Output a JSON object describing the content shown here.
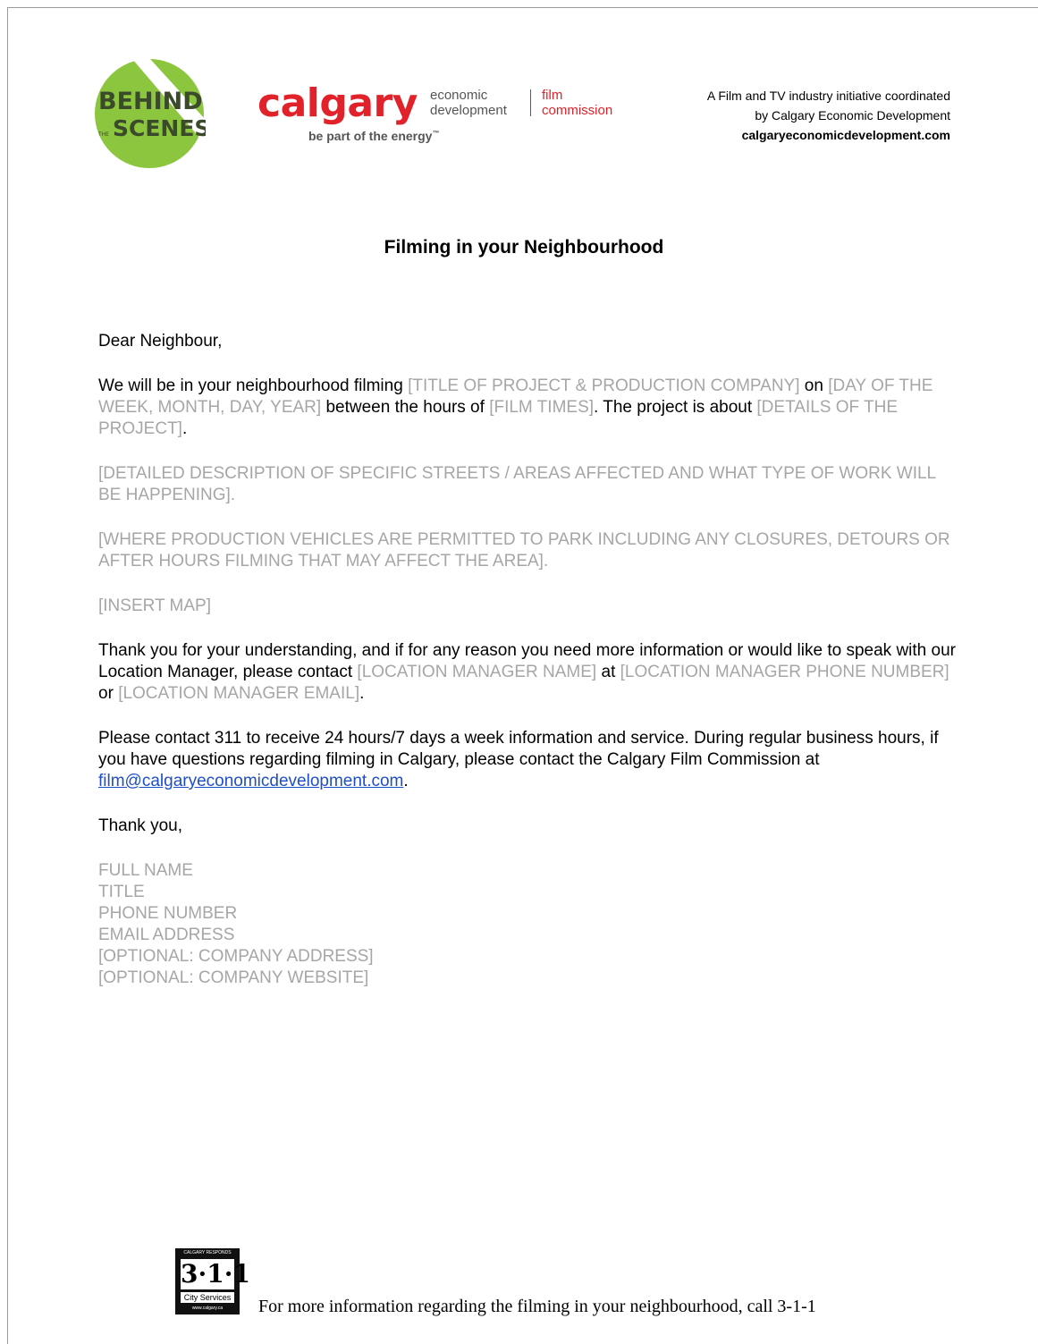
{
  "header": {
    "bts_logo": {
      "line1": "BEHIND",
      "line2_small": "THE",
      "line2": "SCENES"
    },
    "calgary_word": "calgary",
    "econ_dev_line1": "economic",
    "econ_dev_line2": "development",
    "film_comm_line1": "film",
    "film_comm_line2": "commission",
    "tagline": "be part of the energy",
    "tagline_mark": "™",
    "initiative_line1": "A Film and TV industry initiative coordinated",
    "initiative_line2": "by Calgary Economic Development",
    "initiative_url": "calgaryeconomicdevelopment.com"
  },
  "title": "Filming in your Neighbourhood",
  "greeting": "Dear Neighbour,",
  "para1": {
    "t1": "We will be in your neighbourhood filming ",
    "ph1": "[TITLE OF PROJECT & PRODUCTION COMPANY]",
    "t2": " on ",
    "ph2": "[DAY OF THE WEEK, MONTH, DAY, YEAR]",
    "t3": " between the hours of ",
    "ph3": "[FILM TIMES]",
    "t4": ". The project is about ",
    "ph4": "[DETAILS OF THE PROJECT]",
    "t5": "."
  },
  "para2": "[DETAILED DESCRIPTION OF SPECIFIC STREETS / AREAS AFFECTED AND WHAT TYPE OF WORK WILL BE HAPPENING].",
  "para3": "[WHERE PRODUCTION VEHICLES ARE PERMITTED TO PARK INCLUDING ANY CLOSURES, DETOURS OR AFTER HOURS FILMING THAT MAY AFFECT THE AREA].",
  "para4": "[INSERT MAP]",
  "para5": {
    "t1": "Thank you for your understanding, and if for any reason you need more information or would like to speak with our Location Manager, please contact ",
    "ph1": "[LOCATION MANAGER NAME]",
    "t2": " at ",
    "ph2": "[LOCATION MANAGER PHONE NUMBER]",
    "t3": " or ",
    "ph3": "[LOCATION MANAGER EMAIL]",
    "t4": "."
  },
  "para6": {
    "t1": "Please contact 311 to receive 24 hours/7 days a week information and service. During regular business hours, if you have questions regarding filming in Calgary, please contact the Calgary Film Commission at ",
    "email": "film@calgaryeconomicdevelopment.com",
    "t2": "."
  },
  "closing": "Thank you,",
  "signature": [
    "FULL NAME",
    "TITLE",
    "PHONE NUMBER",
    "EMAIL ADDRESS",
    "[OPTIONAL: COMPANY ADDRESS]",
    "[OPTIONAL: COMPANY WEBSITE]"
  ],
  "footer": {
    "logo_top": "CALGARY RESPONDS",
    "logo_number": "3·1·1",
    "logo_services": "City Services",
    "logo_web": "www.calgary.ca",
    "text": "For more information regarding the filming in your neighbourhood, call 3-1-1"
  },
  "colors": {
    "calgary_red": "#e2222a",
    "bts_green": "#8cc63f",
    "placeholder_grey": "#a6a6a6",
    "link_blue": "#1f4fc7"
  }
}
